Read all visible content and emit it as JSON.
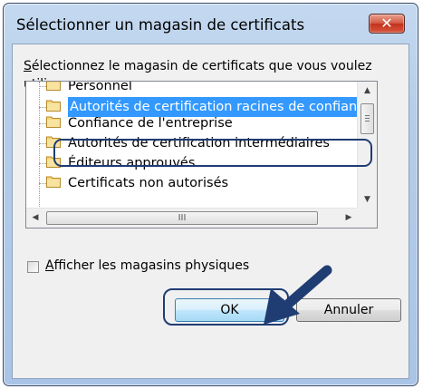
{
  "window": {
    "title": "Sélectionner un magasin de certificats",
    "close_glyph": "✕"
  },
  "dialog": {
    "instruction_access_key": "S",
    "instruction_rest": "électionnez le magasin de certificats que vous voulez utiliser."
  },
  "tree": {
    "items": [
      {
        "label": "Personnel",
        "icon": "folder-icon"
      },
      {
        "label": "Autorités de certification racines de confiance",
        "icon": "folder-icon",
        "selected": true
      },
      {
        "label": "Confiance de l'entreprise",
        "icon": "folder-icon"
      },
      {
        "label": "Autorités de certification intermédiaires",
        "icon": "folder-icon"
      },
      {
        "label": "Éditeurs approuvés",
        "icon": "folder-icon"
      },
      {
        "label": "Certificats non autorisés",
        "icon": "folder-icon"
      }
    ],
    "hscroll_grip": "III"
  },
  "checkbox": {
    "access_key": "A",
    "label_rest": "fficher les magasins physiques",
    "checked": false
  },
  "buttons": {
    "ok": "OK",
    "cancel": "Annuler"
  },
  "colors": {
    "annotation": "#1f3d73",
    "selection": "#3399ff"
  }
}
